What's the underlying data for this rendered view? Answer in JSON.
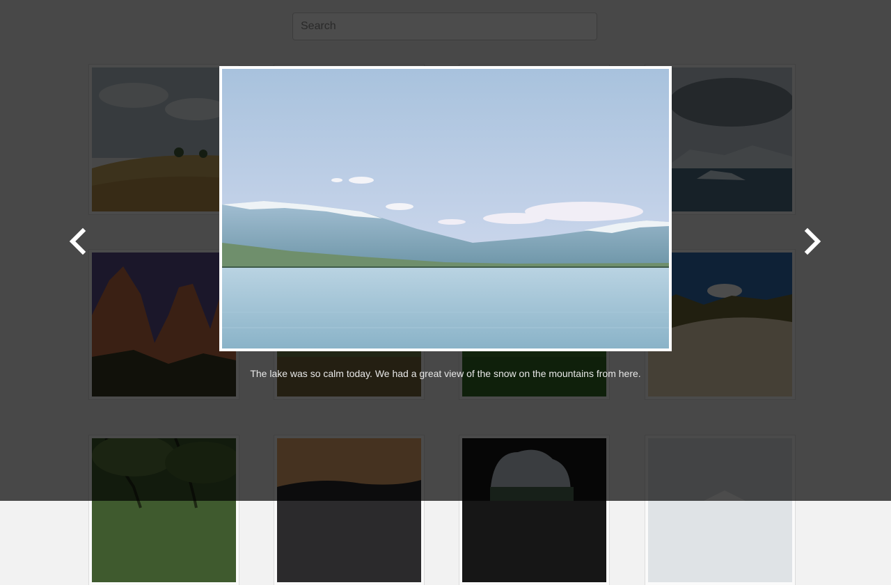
{
  "search": {
    "placeholder": "Search"
  },
  "gallery": {
    "thumbnails": [
      {
        "subject": "prairie-hills"
      },
      {
        "subject": "unknown"
      },
      {
        "subject": "unknown"
      },
      {
        "subject": "glacier-lagoon"
      },
      {
        "subject": "red-rock-canyon"
      },
      {
        "subject": "forest"
      },
      {
        "subject": "grass"
      },
      {
        "subject": "sand-dunes"
      },
      {
        "subject": "woodland-trees"
      },
      {
        "subject": "sunset-hills"
      },
      {
        "subject": "rock-arch"
      },
      {
        "subject": "misty-mountain"
      }
    ]
  },
  "lightbox": {
    "caption": "The lake was so calm today. We had a great view of the snow on the mountains from here.",
    "prev_icon": "chevron-left-icon",
    "next_icon": "chevron-right-icon"
  }
}
